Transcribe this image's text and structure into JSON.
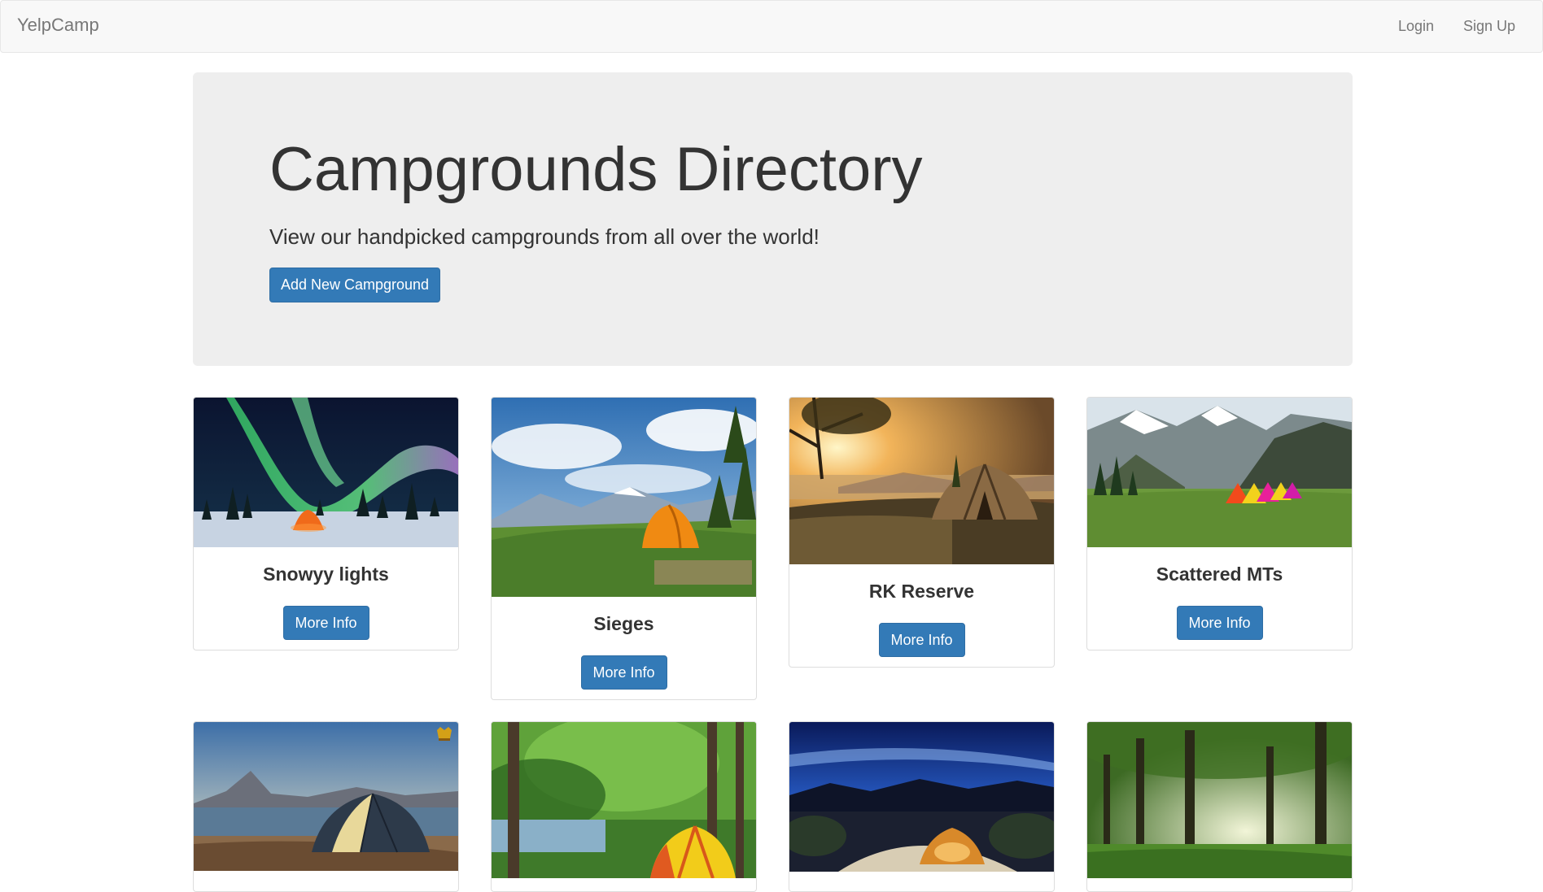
{
  "navbar": {
    "brand": "YelpCamp",
    "login_label": "Login",
    "signup_label": "Sign Up"
  },
  "jumbotron": {
    "title": "Campgrounds Directory",
    "subtitle": "View our handpicked campgrounds from all over the world!",
    "add_button_label": "Add New Campground"
  },
  "campgrounds": [
    {
      "name": "Snowyy lights",
      "button_label": "More Info"
    },
    {
      "name": "Sieges",
      "button_label": "More Info"
    },
    {
      "name": "RK Reserve",
      "button_label": "More Info"
    },
    {
      "name": "Scattered MTs",
      "button_label": "More Info"
    },
    {
      "name": "",
      "button_label": ""
    },
    {
      "name": "",
      "button_label": ""
    },
    {
      "name": "",
      "button_label": ""
    },
    {
      "name": "",
      "button_label": ""
    }
  ],
  "colors": {
    "primary_button": "#337ab7",
    "navbar_bg": "#f8f8f8",
    "jumbotron_bg": "#eeeeee"
  }
}
